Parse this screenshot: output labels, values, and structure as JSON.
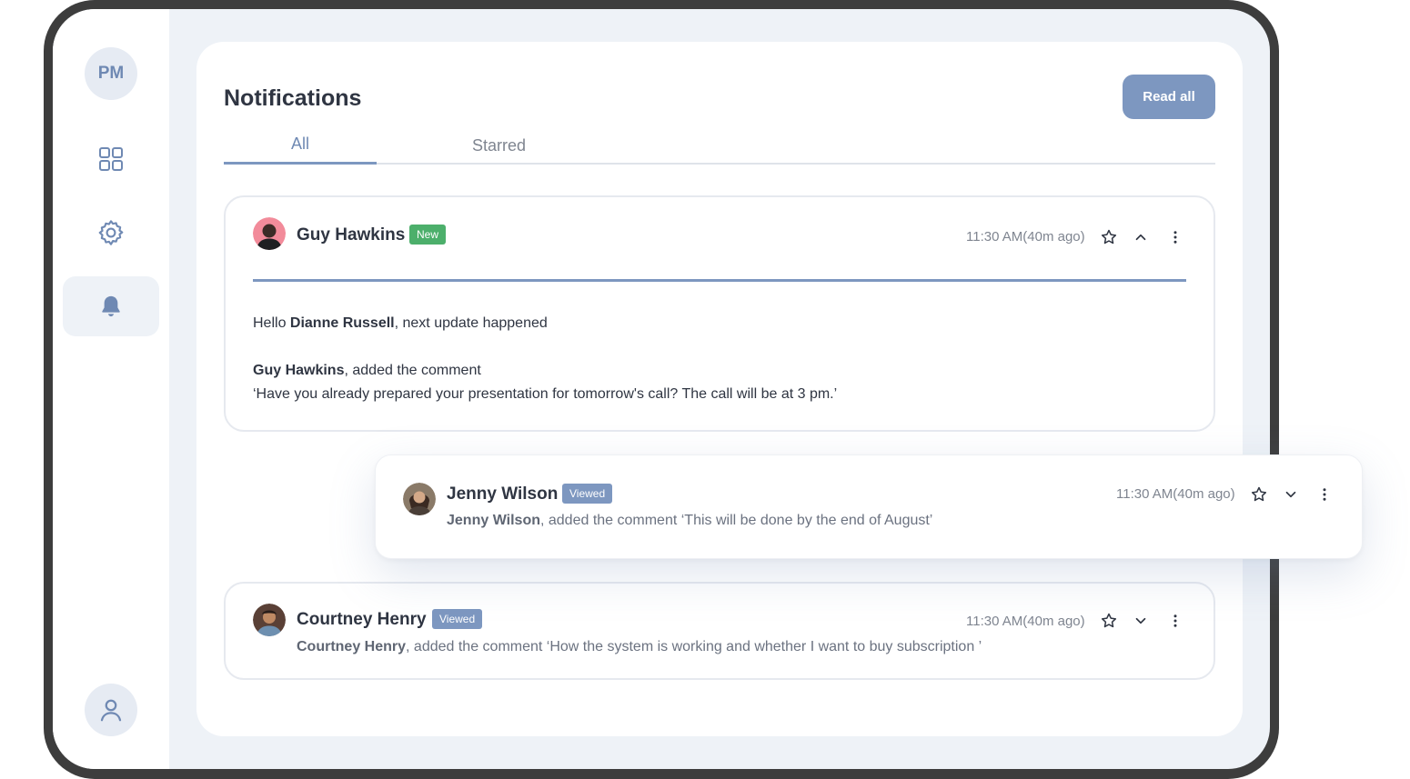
{
  "sidebar": {
    "avatar_initials": "PM",
    "nav_items": [
      {
        "icon": "grid-icon",
        "active": false
      },
      {
        "icon": "gear-icon",
        "active": false
      },
      {
        "icon": "bell-icon",
        "active": true
      }
    ],
    "bottom_icon": "user-icon"
  },
  "header": {
    "title": "Notifications",
    "read_all_label": "Read all"
  },
  "tabs": [
    {
      "label": "All",
      "active": true
    },
    {
      "label": "Starred",
      "active": false
    }
  ],
  "notifications": [
    {
      "name": "Guy Hawkins",
      "badge": "New",
      "time": "11:30 AM(40m ago)",
      "expanded": true,
      "greeting_prefix": "Hello ",
      "greeting_name": "Dianne Russell",
      "greeting_suffix": ", next update happened",
      "actor": "Guy Hawkins",
      "action": ", added the comment",
      "quote": " ‘Have you already prepared your presentation for tomorrow's call? The call will be at 3 pm.’"
    },
    {
      "name": "Jenny Wilson",
      "badge": "Viewed",
      "time": "11:30 AM(40m ago)",
      "expanded": false,
      "actor": "Jenny Wilson",
      "action": ", added the comment  ‘This will be done by the end of August’"
    },
    {
      "name": "Courtney Henry",
      "badge": "Viewed",
      "time": "11:30 AM(40m ago)",
      "expanded": false,
      "actor": "Courtney Henry",
      "action": ", added the comment  ‘How the system is working and whether I want to buy subscription ’"
    }
  ],
  "colors": {
    "accent": "#7d97c0",
    "badge_new": "#4caf6b",
    "badge_viewed": "#7d97c0",
    "background": "#eef2f7"
  }
}
